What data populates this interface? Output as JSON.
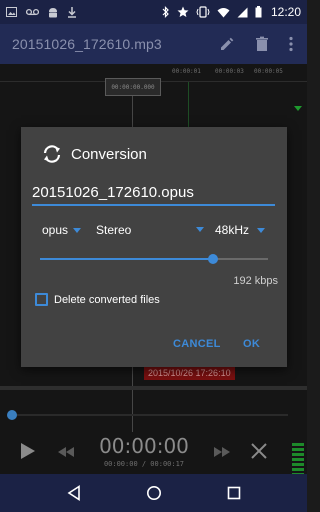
{
  "status_bar": {
    "time": "12:20",
    "left_icons": [
      "image-icon",
      "voicemail-icon",
      "android-icon",
      "download-icon"
    ],
    "right_icons": [
      "bluetooth-icon",
      "star-icon",
      "vibrate-icon",
      "wifi-icon",
      "signal-icon",
      "battery-icon"
    ]
  },
  "toolbar": {
    "title": "20151026_172610.mp3",
    "icons": [
      "edit-icon",
      "delete-icon",
      "more-vert-icon"
    ]
  },
  "background": {
    "ruler_ticks": [
      "00:00:01",
      "00:00:03",
      "00:00:05"
    ],
    "marker_time": "00:00:00.000",
    "timestamp": "2015/10/26 17:26:10",
    "clock": "00:00:00",
    "clock_sub": "00:00:00 / 00:00:17"
  },
  "dialog": {
    "title": "Conversion",
    "filename": "20151026_172610.opus",
    "format": "opus",
    "channels": "Stereo",
    "sample_rate": "48kHz",
    "bitrate_fraction": 0.76,
    "bitrate_label": "192 kbps",
    "delete_label": "Delete converted files",
    "delete_checked": false,
    "cancel_label": "CANCEL",
    "ok_label": "OK"
  },
  "colors": {
    "accent": "#3d8ad8",
    "dialog_bg": "#424242",
    "toolbar_bg": "#222b55",
    "statusbar_bg": "#1b2245"
  }
}
